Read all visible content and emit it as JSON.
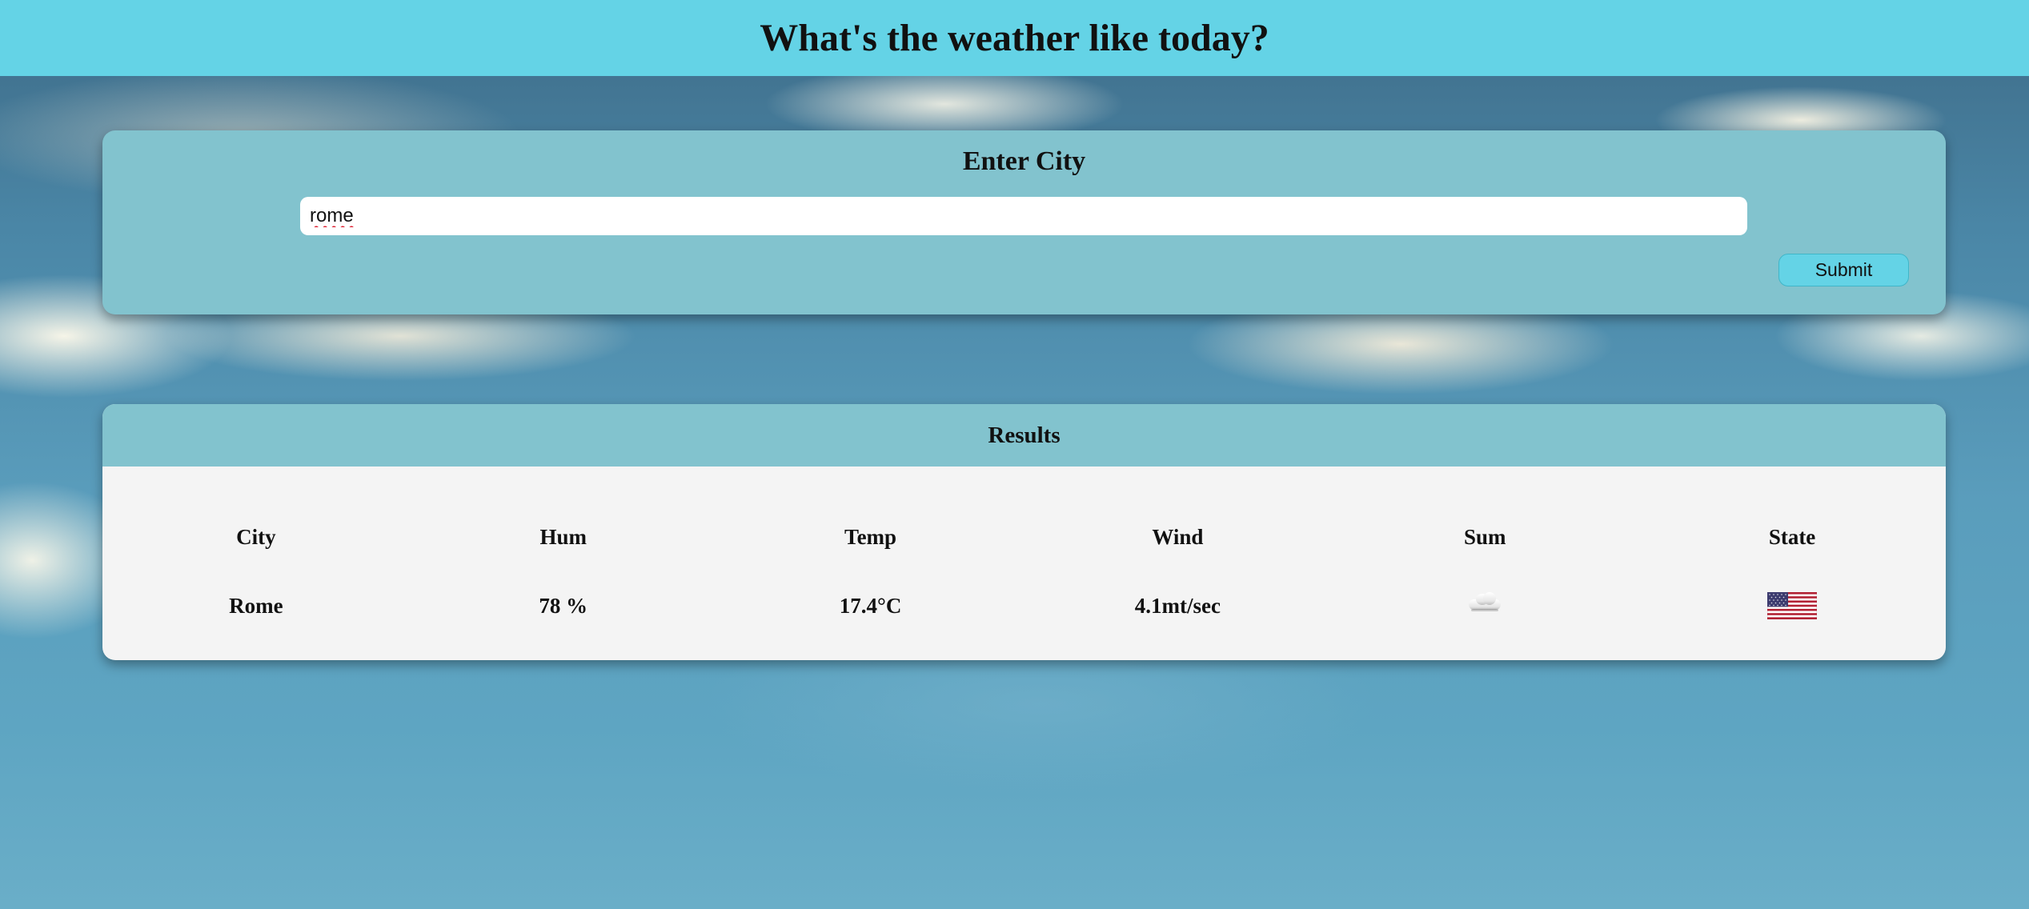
{
  "header": {
    "title": "What's the weather like today?"
  },
  "search": {
    "heading": "Enter City",
    "input_value": "rome",
    "submit_label": "Submit"
  },
  "results": {
    "heading": "Results",
    "columns": [
      "City",
      "Hum",
      "Temp",
      "Wind",
      "Sum",
      "State"
    ],
    "row": {
      "city": "Rome",
      "humidity": "78 %",
      "temp": "17.4°C",
      "wind": "4.1mt/sec",
      "summary_icon": "cloud-icon",
      "state_icon": "us-flag-icon"
    }
  },
  "colors": {
    "topbar": "#64d3e6",
    "card_header": "#82c3ce",
    "button": "#64d3e6",
    "results_body": "#f4f4f4"
  }
}
